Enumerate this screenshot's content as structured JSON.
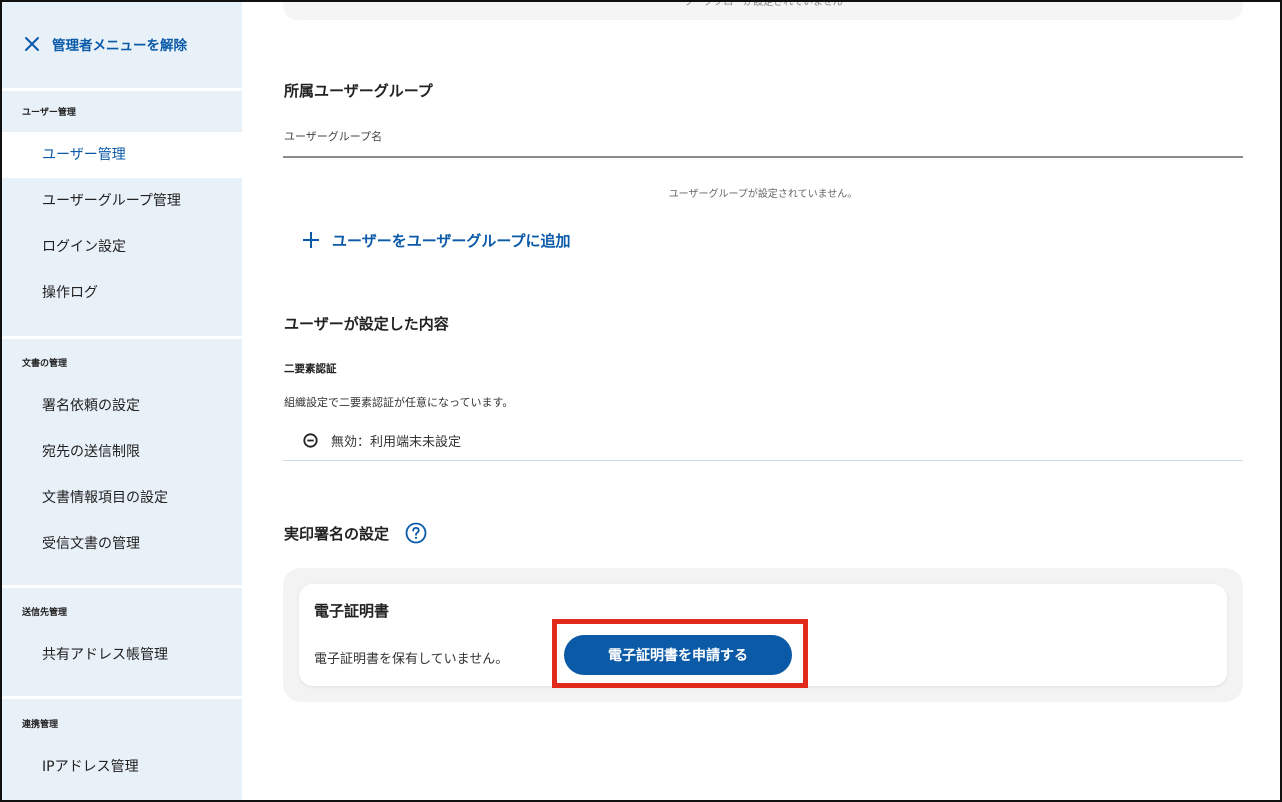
{
  "sidebar": {
    "exit_admin_label": "管理者メニューを解除",
    "sections": [
      {
        "heading": "ユーザー管理",
        "items": [
          "ユーザー管理",
          "ユーザーグループ管理",
          "ログイン設定",
          "操作ログ"
        ]
      },
      {
        "heading": "文書の管理",
        "items": [
          "署名依頼の設定",
          "宛先の送信制限",
          "文書情報項目の設定",
          "受信文書の管理"
        ]
      },
      {
        "heading": "送信先管理",
        "items": [
          "共有アドレス帳管理"
        ]
      },
      {
        "heading": "連携管理",
        "items": [
          "IPアドレス管理"
        ]
      }
    ],
    "active_item": "ユーザー管理"
  },
  "main": {
    "top_card_text": "ワークフローが設定されていません",
    "user_groups": {
      "title": "所属ユーザーグループ",
      "column_header": "ユーザーグループ名",
      "empty_text": "ユーザーグループが設定されていません。",
      "add_link_label": "ユーザーをユーザーグループに追加"
    },
    "user_settings": {
      "title": "ユーザーが設定した内容",
      "two_factor": {
        "heading": "二要素認証",
        "description": "組織設定で二要素認証が任意になっています。",
        "status": "無効：利用端末未設定"
      }
    },
    "seal_signature": {
      "title": "実印署名の設定",
      "certificate": {
        "title": "電子証明書",
        "status": "電子証明書を保有していません。",
        "apply_button": "電子証明書を申請する"
      }
    }
  },
  "colors": {
    "accent": "#0a5aa8",
    "sidebar_bg": "#e8f0f8",
    "highlight": "#e12a1c"
  }
}
